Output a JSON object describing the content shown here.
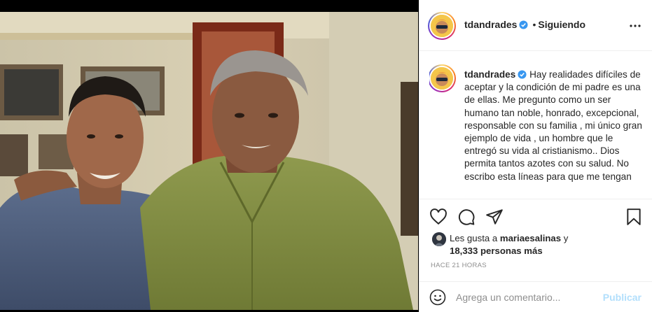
{
  "post": {
    "username": "tdandrades",
    "separator": "•",
    "follow_status": "Siguiendo",
    "caption_text": "Hay realidades difíciles de aceptar y la condición de mi padre es una de ellas. Me pregunto como un ser humano tan noble, honrado, excepcional, responsable con su familia , mi único gran ejemplo de vida , un hombre que le entregó su vida al cristianismo.. Dios permita tantos azotes con su salud. No escribo esta líneas para que me tengan",
    "likes_prefix": "Les gusta a",
    "likes_user": "mariaesalinas",
    "likes_connector": "y",
    "likes_count": "18,333 personas más",
    "timestamp": "HACE 21 HORAS"
  },
  "comment": {
    "placeholder": "Agrega un comentario...",
    "publish_label": "Publicar"
  },
  "icons": {
    "verified": "verified-badge-icon",
    "more": "more-options-icon",
    "like": "heart-icon",
    "comment": "comment-icon",
    "share": "share-icon",
    "save": "bookmark-icon",
    "emoji": "emoji-icon"
  },
  "colors": {
    "verified_blue": "#3897f0",
    "publish_disabled": "#b2dffc",
    "muted_text": "#8e8e8e"
  }
}
